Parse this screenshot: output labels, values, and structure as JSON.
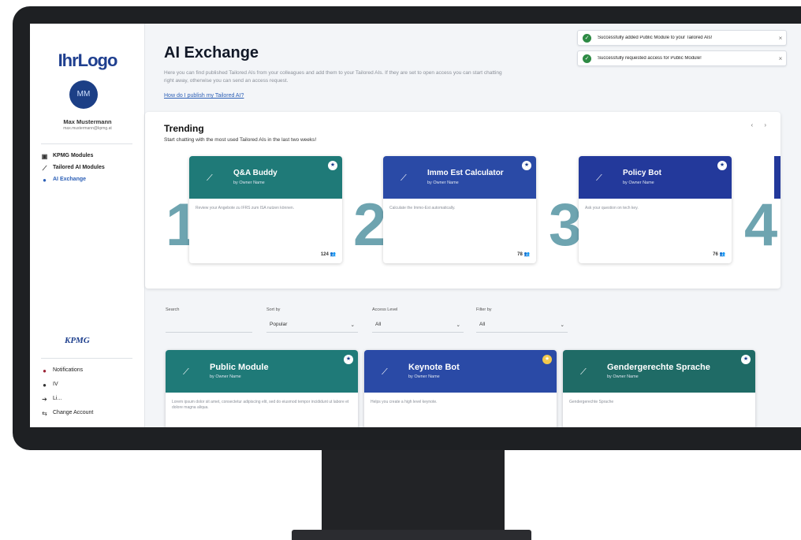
{
  "colors": {
    "teal": "#1f7a78",
    "blue": "#2a4aa6",
    "navy": "#1f3f8f",
    "rank": "#6ea4b0",
    "success": "#2d8a44"
  },
  "sidebar": {
    "logo": "IhrLogo",
    "avatar_initials": "MM",
    "user_name": "Max Mustermann",
    "user_email": "max.mustermann@kpmg.at",
    "nav_items": [
      {
        "label": "KPMG Modules",
        "icon": "grid-icon"
      },
      {
        "label": "Tailored AI Modules",
        "icon": "wand-icon"
      },
      {
        "label": "AI Exchange",
        "icon": "circle-icon"
      }
    ],
    "brand": "KPMG",
    "bottom_items": [
      {
        "label": "Notifications",
        "icon": "bell-icon"
      },
      {
        "label": "IV",
        "icon": "dot-icon"
      },
      {
        "label": "Li...",
        "icon": "arrow-icon"
      },
      {
        "label": "Change Account",
        "icon": "switch-icon"
      }
    ]
  },
  "header": {
    "title": "AI Exchange",
    "description": "Here you can find published Tailored AIs from your colleagues and add them to your Tailored AIs. If they are set to open access you can start chatting right away, otherwise you can send an access request.",
    "help_link": "How do I publish my Tailored AI?"
  },
  "toasts": [
    {
      "text": "Successfully added Public Module to your Tailored AIs!",
      "close": "×"
    },
    {
      "text": "Successfully requested access for Public Module!",
      "close": "×"
    }
  ],
  "trending": {
    "title": "Trending",
    "subtitle": "Start chatting with the most used Tailored AIs in the last two weeks!",
    "nav": "‹ ›",
    "cards": [
      {
        "rank": "1",
        "name": "Q&A Buddy",
        "owner": "by Owner Name",
        "description": "Review your Angebote zu IFRS zum ISA nutzen können.",
        "users": "124"
      },
      {
        "rank": "2",
        "name": "Immo Est Calculator",
        "owner": "by Owner Name",
        "description": "Calculate the Immo-Est automatically.",
        "users": "78"
      },
      {
        "rank": "3",
        "name": "Policy Bot",
        "owner": "by Owner Name",
        "description": "Ask your question on tech key.",
        "users": "76"
      }
    ],
    "next_rank": "4"
  },
  "filters": [
    {
      "label": "Search",
      "value": ""
    },
    {
      "label": "Sort by",
      "value": "Popular"
    },
    {
      "label": "Access Level",
      "value": "All"
    },
    {
      "label": "Filter by",
      "value": "All"
    }
  ],
  "modules": [
    {
      "name": "Public Module",
      "owner": "by Owner Name",
      "description": "Lorem ipsum dolor sit amet, consectetur adipiscing elit, sed do eiusmod tempor incididunt ut labore et dolore magna aliqua."
    },
    {
      "name": "Keynote Bot",
      "owner": "by Owner Name",
      "description": "Helps you create a high level keynote."
    },
    {
      "name": "Gendergerechte Sprache",
      "owner": "by Owner Name",
      "description": "Gendergerechte Sprache"
    }
  ]
}
